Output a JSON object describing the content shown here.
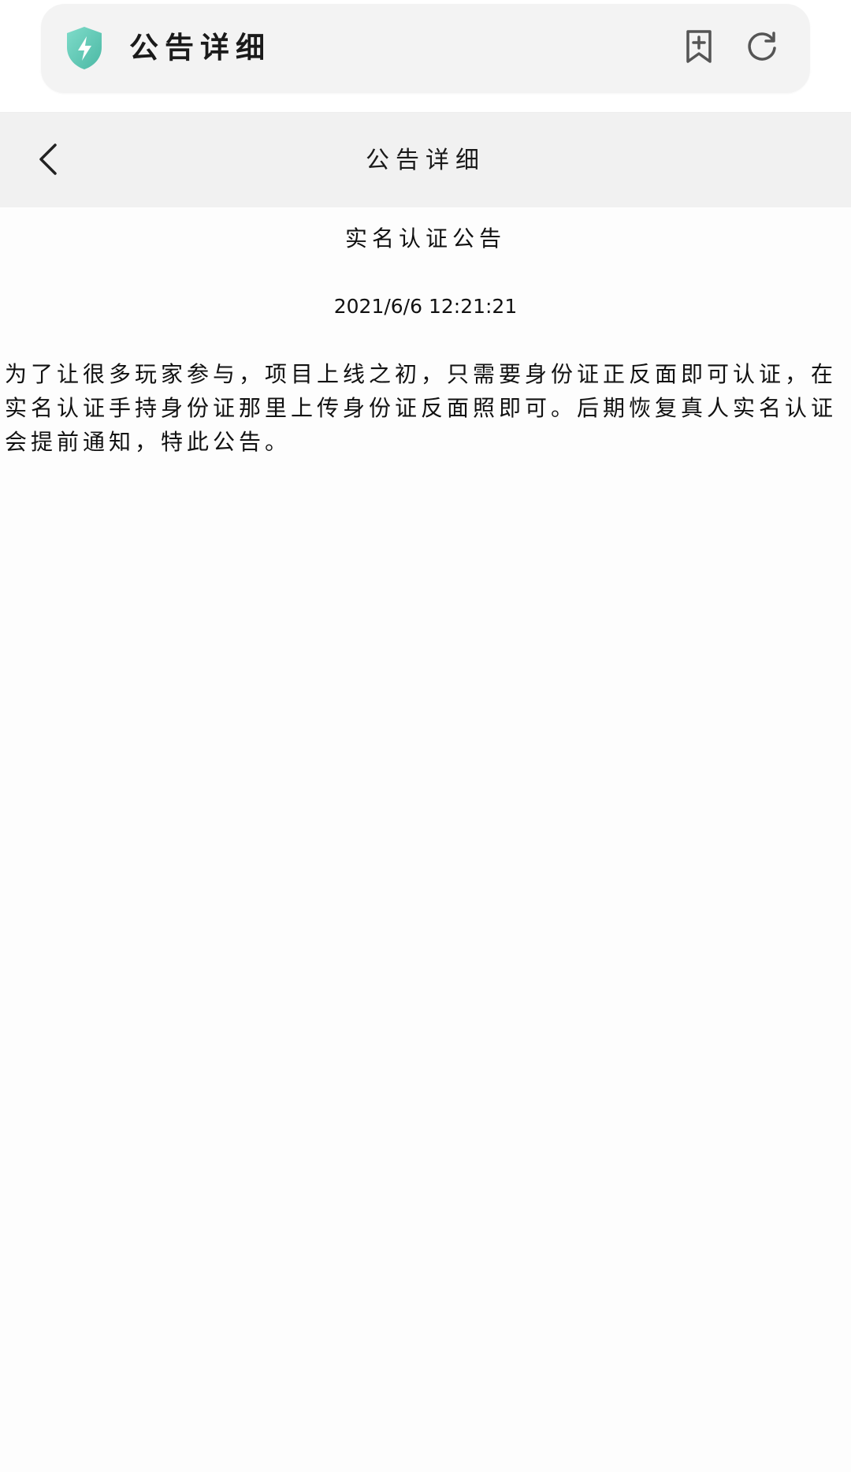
{
  "browser": {
    "title": "公告详细",
    "shield_icon": "shield-bolt-icon",
    "bookmark_icon": "bookmark-add-icon",
    "refresh_icon": "refresh-icon",
    "accent_color": "#5fc9b4"
  },
  "header": {
    "title": "公告详细",
    "back_icon": "chevron-left-icon"
  },
  "notice": {
    "title": "实名认证公告",
    "time": "2021/6/6 12:21:21",
    "body": "为了让很多玩家参与，项目上线之初，只需要身份证正反面即可认证，在实名认证手持身份证那里上传身份证反面照即可。后期恢复真人实名认证会提前通知，特此公告。"
  }
}
